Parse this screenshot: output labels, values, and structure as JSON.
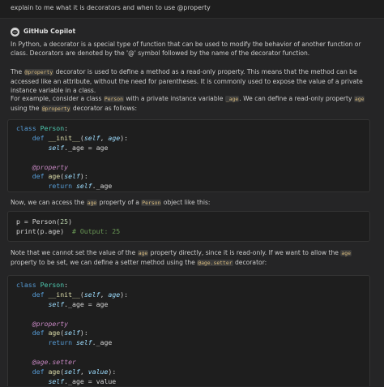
{
  "user_message": "explain to me what it is decorators and when to use @property",
  "assistant": {
    "name": "GitHub Copilot",
    "avatar_icon": "copilot-icon"
  },
  "paragraphs": {
    "p1": "In Python, a decorator is a special type of function that can be used to modify the behavior of another function or class. Decorators are denoted by the '@' symbol followed by the name of the decorator function.",
    "p2_a": "The ",
    "p2_code": "@property",
    "p2_b": " decorator is used to define a method as a read-only property. This means that the method can be accessed like an attribute, without the need for parentheses. It is commonly used to expose the value of a private instance variable in a class.",
    "p3_a": "For example, consider a class ",
    "p3_code1": "Person",
    "p3_b": " with a private instance variable ",
    "p3_code2": "_age",
    "p3_c": ". We can define a read-only property ",
    "p3_code3": "age",
    "p3_d": " using the ",
    "p3_code4": "@property",
    "p3_e": " decorator as follows:",
    "p4_a": "Now, we can access the ",
    "p4_code1": "age",
    "p4_b": " property of a ",
    "p4_code2": "Person",
    "p4_c": " object like this:",
    "p5_a": "Note that we cannot set the value of the ",
    "p5_code1": "age",
    "p5_b": " property directly, since it is read-only. If we want to allow the ",
    "p5_code2": "age",
    "p5_c": " property to be set, we can define a setter method using the ",
    "p5_code3": "@age.setter",
    "p5_d": " decorator:"
  },
  "code1": {
    "l1_kw": "class",
    "l1_name": "Person",
    "l2_kw": "def",
    "l2_fn": "__init__",
    "l2_self": "self",
    "l2_arg": "age",
    "l3_self": "self",
    "l3_rest": "._age = age",
    "l5_dec": "@property",
    "l6_kw": "def",
    "l6_fn": "age",
    "l6_self": "self",
    "l7_kw": "return",
    "l7_self": "self",
    "l7_rest": "._age"
  },
  "code2": {
    "l1_a": "p = Person(",
    "l1_num": "25",
    "l1_b": ")",
    "l2_a": "print(p.age)",
    "l2_comment": "# Output: 25"
  },
  "code3": {
    "l1_kw": "class",
    "l1_name": "Person",
    "l2_kw": "def",
    "l2_fn": "__init__",
    "l2_self": "self",
    "l2_arg": "age",
    "l3_self": "self",
    "l3_rest": "._age = age",
    "l5_dec": "@property",
    "l6_kw": "def",
    "l6_fn": "age",
    "l6_self": "self",
    "l7_kw": "return",
    "l7_self": "self",
    "l7_rest": "._age",
    "l9_dec": "@age.setter",
    "l10_kw": "def",
    "l10_fn": "age",
    "l10_self": "self",
    "l10_arg": "value",
    "l11_self": "self",
    "l11_rest": "._age = value"
  },
  "colors": {
    "background": "#252526",
    "code_background": "#1e1e1e",
    "keyword": "#569cd6",
    "function": "#dcdcaa",
    "parameter": "#9cdcfe",
    "comment": "#6a9955",
    "inline_code": "#d7ba7d"
  }
}
